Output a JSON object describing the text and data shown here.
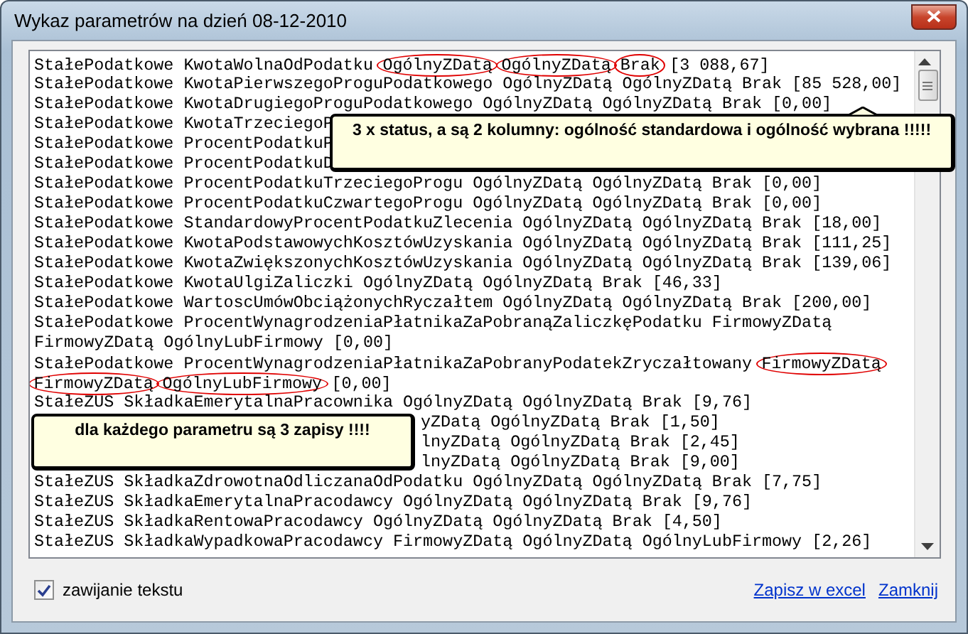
{
  "window": {
    "title": "Wykaz parametrów na dzień 08-12-2010"
  },
  "text_view": {
    "lines": [
      {
        "kind": "segmented",
        "segments": [
          {
            "text": "StałePodatkowe KwotaWolnaOdPodatku",
            "circled": false
          },
          {
            "text": "OgólnyZDatą",
            "circled": true
          },
          {
            "text": "OgólnyZDatą",
            "circled": true
          },
          {
            "text": "Brak",
            "circled": true
          },
          {
            "text": "[3 088,67]",
            "circled": false
          }
        ]
      },
      {
        "kind": "full",
        "text": "StałePodatkowe KwotaPierwszegoProguPodatkowego OgólnyZDatą OgólnyZDatą Brak [85 528,00]"
      },
      {
        "kind": "full",
        "text": "StałePodatkowe KwotaDrugiegoProguPodatkowego OgólnyZDatą OgólnyZDatą Brak [0,00]"
      },
      {
        "kind": "full",
        "text": "StałePodatkowe KwotaTrzeciegoP"
      },
      {
        "kind": "full",
        "text": "StałePodatkowe ProcentPodatkuP"
      },
      {
        "kind": "full",
        "text": "StałePodatkowe ProcentPodatkuD"
      },
      {
        "kind": "full",
        "text": "StałePodatkowe ProcentPodatkuTrzeciegoProgu OgólnyZDatą OgólnyZDatą Brak [0,00]"
      },
      {
        "kind": "full",
        "text": "StałePodatkowe ProcentPodatkuCzwartegoProgu OgólnyZDatą OgólnyZDatą Brak [0,00]"
      },
      {
        "kind": "full",
        "text": "StałePodatkowe StandardowyProcentPodatkuZlecenia OgólnyZDatą OgólnyZDatą Brak [18,00]"
      },
      {
        "kind": "full",
        "text": "StałePodatkowe KwotaPodstawowychKosztówUzyskania OgólnyZDatą OgólnyZDatą Brak [111,25]"
      },
      {
        "kind": "full",
        "text": "StałePodatkowe KwotaZwiększonychKosztówUzyskania OgólnyZDatą OgólnyZDatą Brak [139,06]"
      },
      {
        "kind": "full",
        "text": "StałePodatkowe KwotaUlgiZaliczki OgólnyZDatą OgólnyZDatą Brak [46,33]"
      },
      {
        "kind": "full",
        "text": "StałePodatkowe WartoscUmówObciążonychRyczałtem OgólnyZDatą OgólnyZDatą Brak [200,00]"
      },
      {
        "kind": "full",
        "text": "StałePodatkowe ProcentWynagrodzeniaPłatnikaZaPobranąZaliczkęPodatku FirmowyZDatą"
      },
      {
        "kind": "full",
        "text": "FirmowyZDatą OgólnyLubFirmowy [0,00]"
      },
      {
        "kind": "segmented",
        "segments": [
          {
            "text": "StałePodatkowe ProcentWynagrodzeniaPłatnikaZaPobranyPodatekZryczałtowany",
            "circled": false
          },
          {
            "text": "FirmowyZDatą",
            "circled": true
          }
        ]
      },
      {
        "kind": "segmented",
        "segments": [
          {
            "text": "FirmowyZDatą",
            "circled": true
          },
          {
            "text": "OgólnyLubFirmowy",
            "circled": true
          },
          {
            "text": "[0,00]",
            "circled": false
          }
        ]
      },
      {
        "kind": "full",
        "text": "StałeZUS SkładkaEmerytalnaPracownika OgólnyZDatą OgólnyZDatą Brak [9,76]"
      },
      {
        "kind": "after_callout",
        "text": "yZDatą OgólnyZDatą Brak [1,50]"
      },
      {
        "kind": "after_callout",
        "text": "lnyZDatą OgólnyZDatą Brak [2,45]"
      },
      {
        "kind": "after_callout",
        "text": "lnyZDatą OgólnyZDatą Brak [9,00]"
      },
      {
        "kind": "full",
        "text": "StałeZUS SkładkaZdrowotnaOdliczanaOdPodatku OgólnyZDatą OgólnyZDatą Brak [7,75]"
      },
      {
        "kind": "full",
        "text": "StałeZUS SkładkaEmerytalnaPracodawcy OgólnyZDatą OgólnyZDatą Brak [9,76]"
      },
      {
        "kind": "full",
        "text": "StałeZUS SkładkaRentowaPracodawcy OgólnyZDatą OgólnyZDatą Brak [4,50]"
      },
      {
        "kind": "full",
        "text": "StałeZUS SkładkaWypadkowaPracodawcy FirmowyZDatą OgólnyZDatą OgólnyLubFirmowy [2,26]"
      }
    ]
  },
  "callouts": [
    {
      "text": "3 x status, a są 2 kolumny: ogólność standardowa i ogólność wybrana !!!!!"
    },
    {
      "text": "dla każdego parametru są 3 zapisy !!!!"
    }
  ],
  "wrap_text": {
    "label": "zawijanie tekstu",
    "checked": true
  },
  "links": [
    "Zapisz w excel",
    "Zamknij"
  ]
}
